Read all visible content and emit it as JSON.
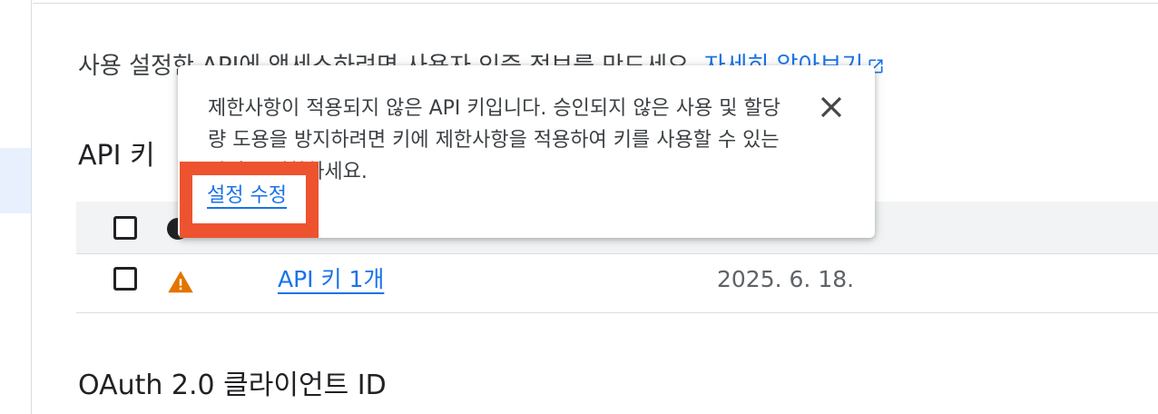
{
  "intro": {
    "text": "사용 설정한 API에 액세스하려면 사용자 인증 정보를 만드세요.",
    "learn_more": "자세히 알아보기"
  },
  "api_keys": {
    "title": "API 키",
    "rows": [
      {
        "name": "API 키 1개",
        "created": "2025. 6. 18.",
        "status_icon": "warning-icon"
      }
    ]
  },
  "tooltip": {
    "message": "제한사항이 적용되지 않은 API 키입니다. 승인되지 않은 사용 및 할당량 도용을 방지하려면 키에 제한사항을 적용하여 키를 사용할 수 있는 방식을 제한하세요.",
    "action": "설정 수정",
    "close_icon": "close-icon"
  },
  "oauth": {
    "title": "OAuth 2.0 클라이언트 ID"
  },
  "colors": {
    "link": "#1a73e8",
    "warning": "#e37400",
    "highlight": "#ee5330"
  }
}
